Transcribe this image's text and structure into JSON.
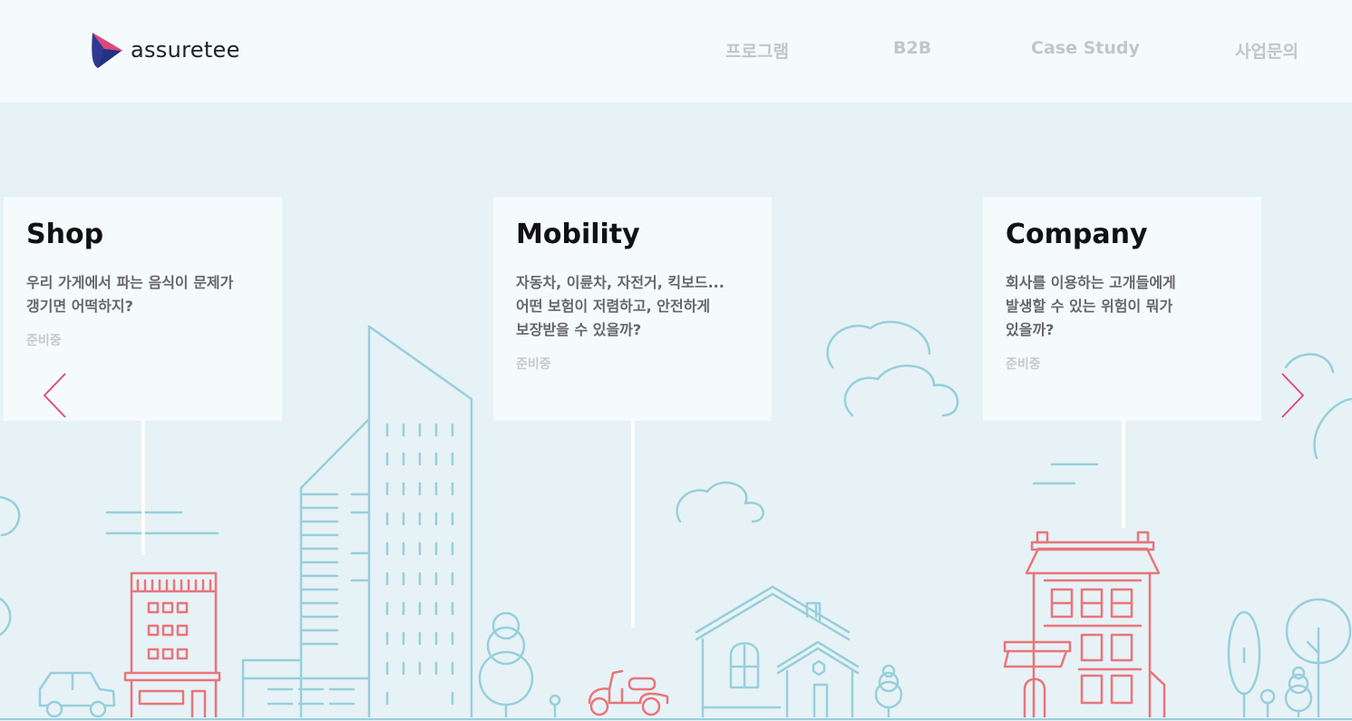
{
  "brand": {
    "name": "assuretee"
  },
  "nav": {
    "program": "프로그램",
    "b2b": "B2B",
    "case_study": "Case Study",
    "contact": "사업문의"
  },
  "cards": [
    {
      "title": "Shop",
      "desc_line1": "우리 가게에서 파는 음식이 문제가",
      "desc_line2": "갱기면 어떡하지?",
      "desc_line3": "",
      "status": "준비중"
    },
    {
      "title": "Mobility",
      "desc_line1": "자동차, 이륜차, 자전거, 킥보드...",
      "desc_line2": "어떤 보험이 저렴하고, 안전하게",
      "desc_line3": "보장받을 수 있을까?",
      "status": "준비중"
    },
    {
      "title": "Company",
      "desc_line1": "회사를 이용하는 고개들에게",
      "desc_line2": "발생할 수 있는 위험이 뭐가",
      "desc_line3": "있을까?",
      "status": "준비중"
    }
  ],
  "colors": {
    "accent": "#e0457b",
    "line_blue": "#97cfdc",
    "line_red": "#e8757a",
    "background": "#e7f2f6"
  },
  "icons": {
    "prev": "chevron-left-icon",
    "next": "chevron-right-icon"
  }
}
